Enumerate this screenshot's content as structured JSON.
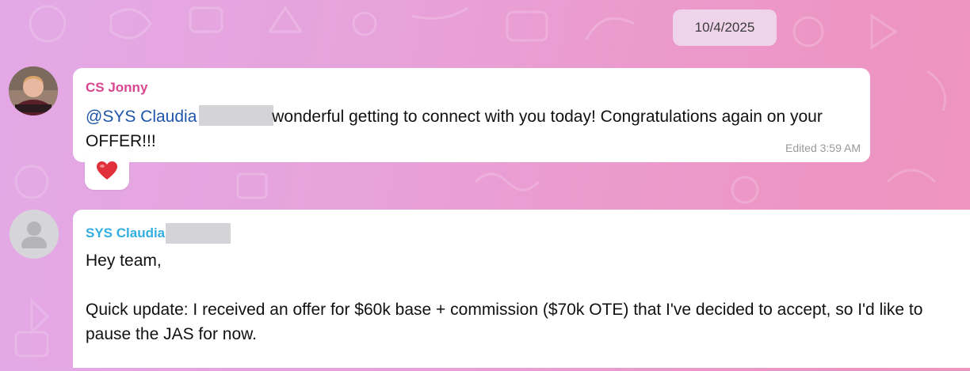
{
  "date_divider": "10/4/2025",
  "messages": [
    {
      "sender": "CS Jonny",
      "mention": "@SYS Claudia",
      "text_rest": " wonderful getting to connect with you today! Congratulations again on your OFFER!!!",
      "edited_label": "Edited 3:59 AM",
      "reaction": "heart",
      "sender_color": "#d9468f"
    },
    {
      "sender": "SYS Claudia",
      "paragraphs": [
        "Hey team,",
        "Quick update: I received an offer for $60k base + commission ($70k OTE) that I've decided to accept, so I'd like to pause the JAS for now."
      ],
      "sender_color": "#33aee0"
    }
  ],
  "colors": {
    "mention": "#1f55a8",
    "reaction_heart": "#e0303a"
  }
}
